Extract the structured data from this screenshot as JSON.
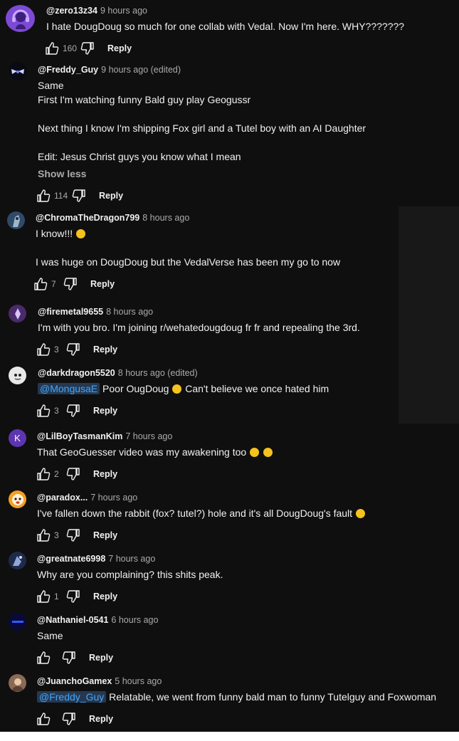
{
  "reply_label": "Reply",
  "show_less_label": "Show less",
  "colors": {
    "background": "#0f0f0f",
    "mention": "#3ea6ff",
    "text": "#f1f1f1",
    "meta": "#aaaaaa"
  },
  "comments": [
    {
      "author": "@zero13z34",
      "time": "9 hours ago",
      "likes": "160",
      "text": [
        "I hate DougDoug so much for one collab with Vedal. Now I'm here. WHY???????"
      ]
    },
    {
      "author": "@Freddy_Guy",
      "time": "9 hours ago (edited)",
      "likes": "114",
      "text": [
        "Same",
        "First I'm watching funny Bald guy play Geogussr",
        "",
        "Next thing I know I'm shipping Fox girl and a Tutel boy with an AI Daughter",
        "",
        "Edit: Jesus Christ guys you know what I mean"
      ]
    },
    {
      "author": "@ChromaTheDragon799",
      "time": "8 hours ago",
      "likes": "7",
      "text": [
        "I know!!!",
        "",
        "I was huge on DougDoug but the VedalVerse has been my go to now"
      ]
    },
    {
      "author": "@firemetal9655",
      "time": "8 hours ago",
      "likes": "3",
      "text": [
        "I'm with you bro. I'm joining r/wehatedougdoug fr fr and repealing the 3rd."
      ]
    },
    {
      "author": "@darkdragon5520",
      "time": "8 hours ago (edited)",
      "likes": "3",
      "mention": "@MongusaE",
      "text": [
        "Poor OugDoug",
        "Can't believe we once hated him"
      ]
    },
    {
      "author": "@LilBoyTasmanKim",
      "time": "7 hours ago",
      "likes": "2",
      "avatar_letter": "K",
      "text": [
        "That GeoGuesser video was my awakening too"
      ]
    },
    {
      "author": "@paradox...",
      "time": "7 hours ago",
      "likes": "3",
      "text": [
        "I've fallen down the rabbit (fox? tutel?) hole and it's all DougDoug's fault"
      ]
    },
    {
      "author": "@greatnate6998",
      "time": "7 hours ago",
      "likes": "1",
      "text": [
        "Why are you complaining? this shits peak."
      ]
    },
    {
      "author": "@Nathaniel-0541",
      "time": "6 hours ago",
      "likes": "",
      "text": [
        "Same"
      ]
    },
    {
      "author": "@JuanchoGamex",
      "time": "5 hours ago",
      "likes": "",
      "mention": "@Freddy_Guy",
      "text": [
        "Relatable, we went from funny bald man to funny Tutelguy and Foxwoman"
      ]
    }
  ]
}
